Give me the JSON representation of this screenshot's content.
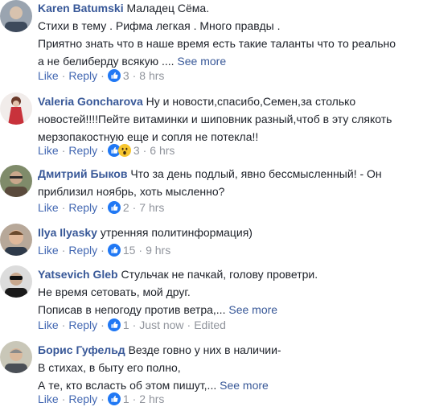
{
  "comments": [
    {
      "author": "Karen Batumski",
      "lines": [
        "Маладец Сёма.",
        "Стихи в тему . Рифма легкая . Много правды .",
        "Приятно знать что в наше время есть такие таланты что то реально",
        "а не белиберду всякую .... "
      ],
      "see_more": "See more",
      "like": "Like",
      "reply": "Reply",
      "count": "3",
      "time": "8 hrs",
      "edited": ""
    },
    {
      "author": "Valeria Goncharova",
      "lines": [
        "Ну и новости,спасибо,Семен,за столько",
        "новостей!!!!Пейте витаминки и шиповник разный,чтоб в эту слякоть",
        "мерзопакостную еще и сопля не потекла!!"
      ],
      "see_more": "",
      "like": "Like",
      "reply": "Reply",
      "count": "3",
      "time": "6 hrs",
      "edited": ""
    },
    {
      "author": "Дмитрий Быков",
      "lines": [
        "Что за день подлый, явно бессмысленный! - Он",
        "приблизил ноябрь, хоть мысленно?"
      ],
      "see_more": "",
      "like": "Like",
      "reply": "Reply",
      "count": "2",
      "time": "7 hrs",
      "edited": ""
    },
    {
      "author": "Ilya Ilyasky",
      "lines": [
        "утренняя политинформация)"
      ],
      "see_more": "",
      "like": "Like",
      "reply": "Reply",
      "count": "15",
      "time": "9 hrs",
      "edited": ""
    },
    {
      "author": "Yatsevich Gleb",
      "lines": [
        "Стульчак не пачкай, голову проветри.",
        "Не время сетовать, мой друг.",
        "Пописав в непогоду против ветра,... "
      ],
      "see_more": "See more",
      "like": "Like",
      "reply": "Reply",
      "count": "1",
      "time": "Just now",
      "edited": "Edited"
    },
    {
      "author": "Борис Гуфельд",
      "lines": [
        "Везде говно у них в наличии-",
        "В стихах, в быту его полно,",
        "А те, кто всласть об этом пишут,... "
      ],
      "see_more": "See more",
      "like": "Like",
      "reply": "Reply",
      "count": "1",
      "time": "2 hrs",
      "edited": ""
    }
  ],
  "colors": {
    "link": "#385898",
    "action": "#4267b2",
    "meta": "#90949c",
    "like_blue": "#2078f4",
    "wow_yellow": "#f7c52e"
  }
}
